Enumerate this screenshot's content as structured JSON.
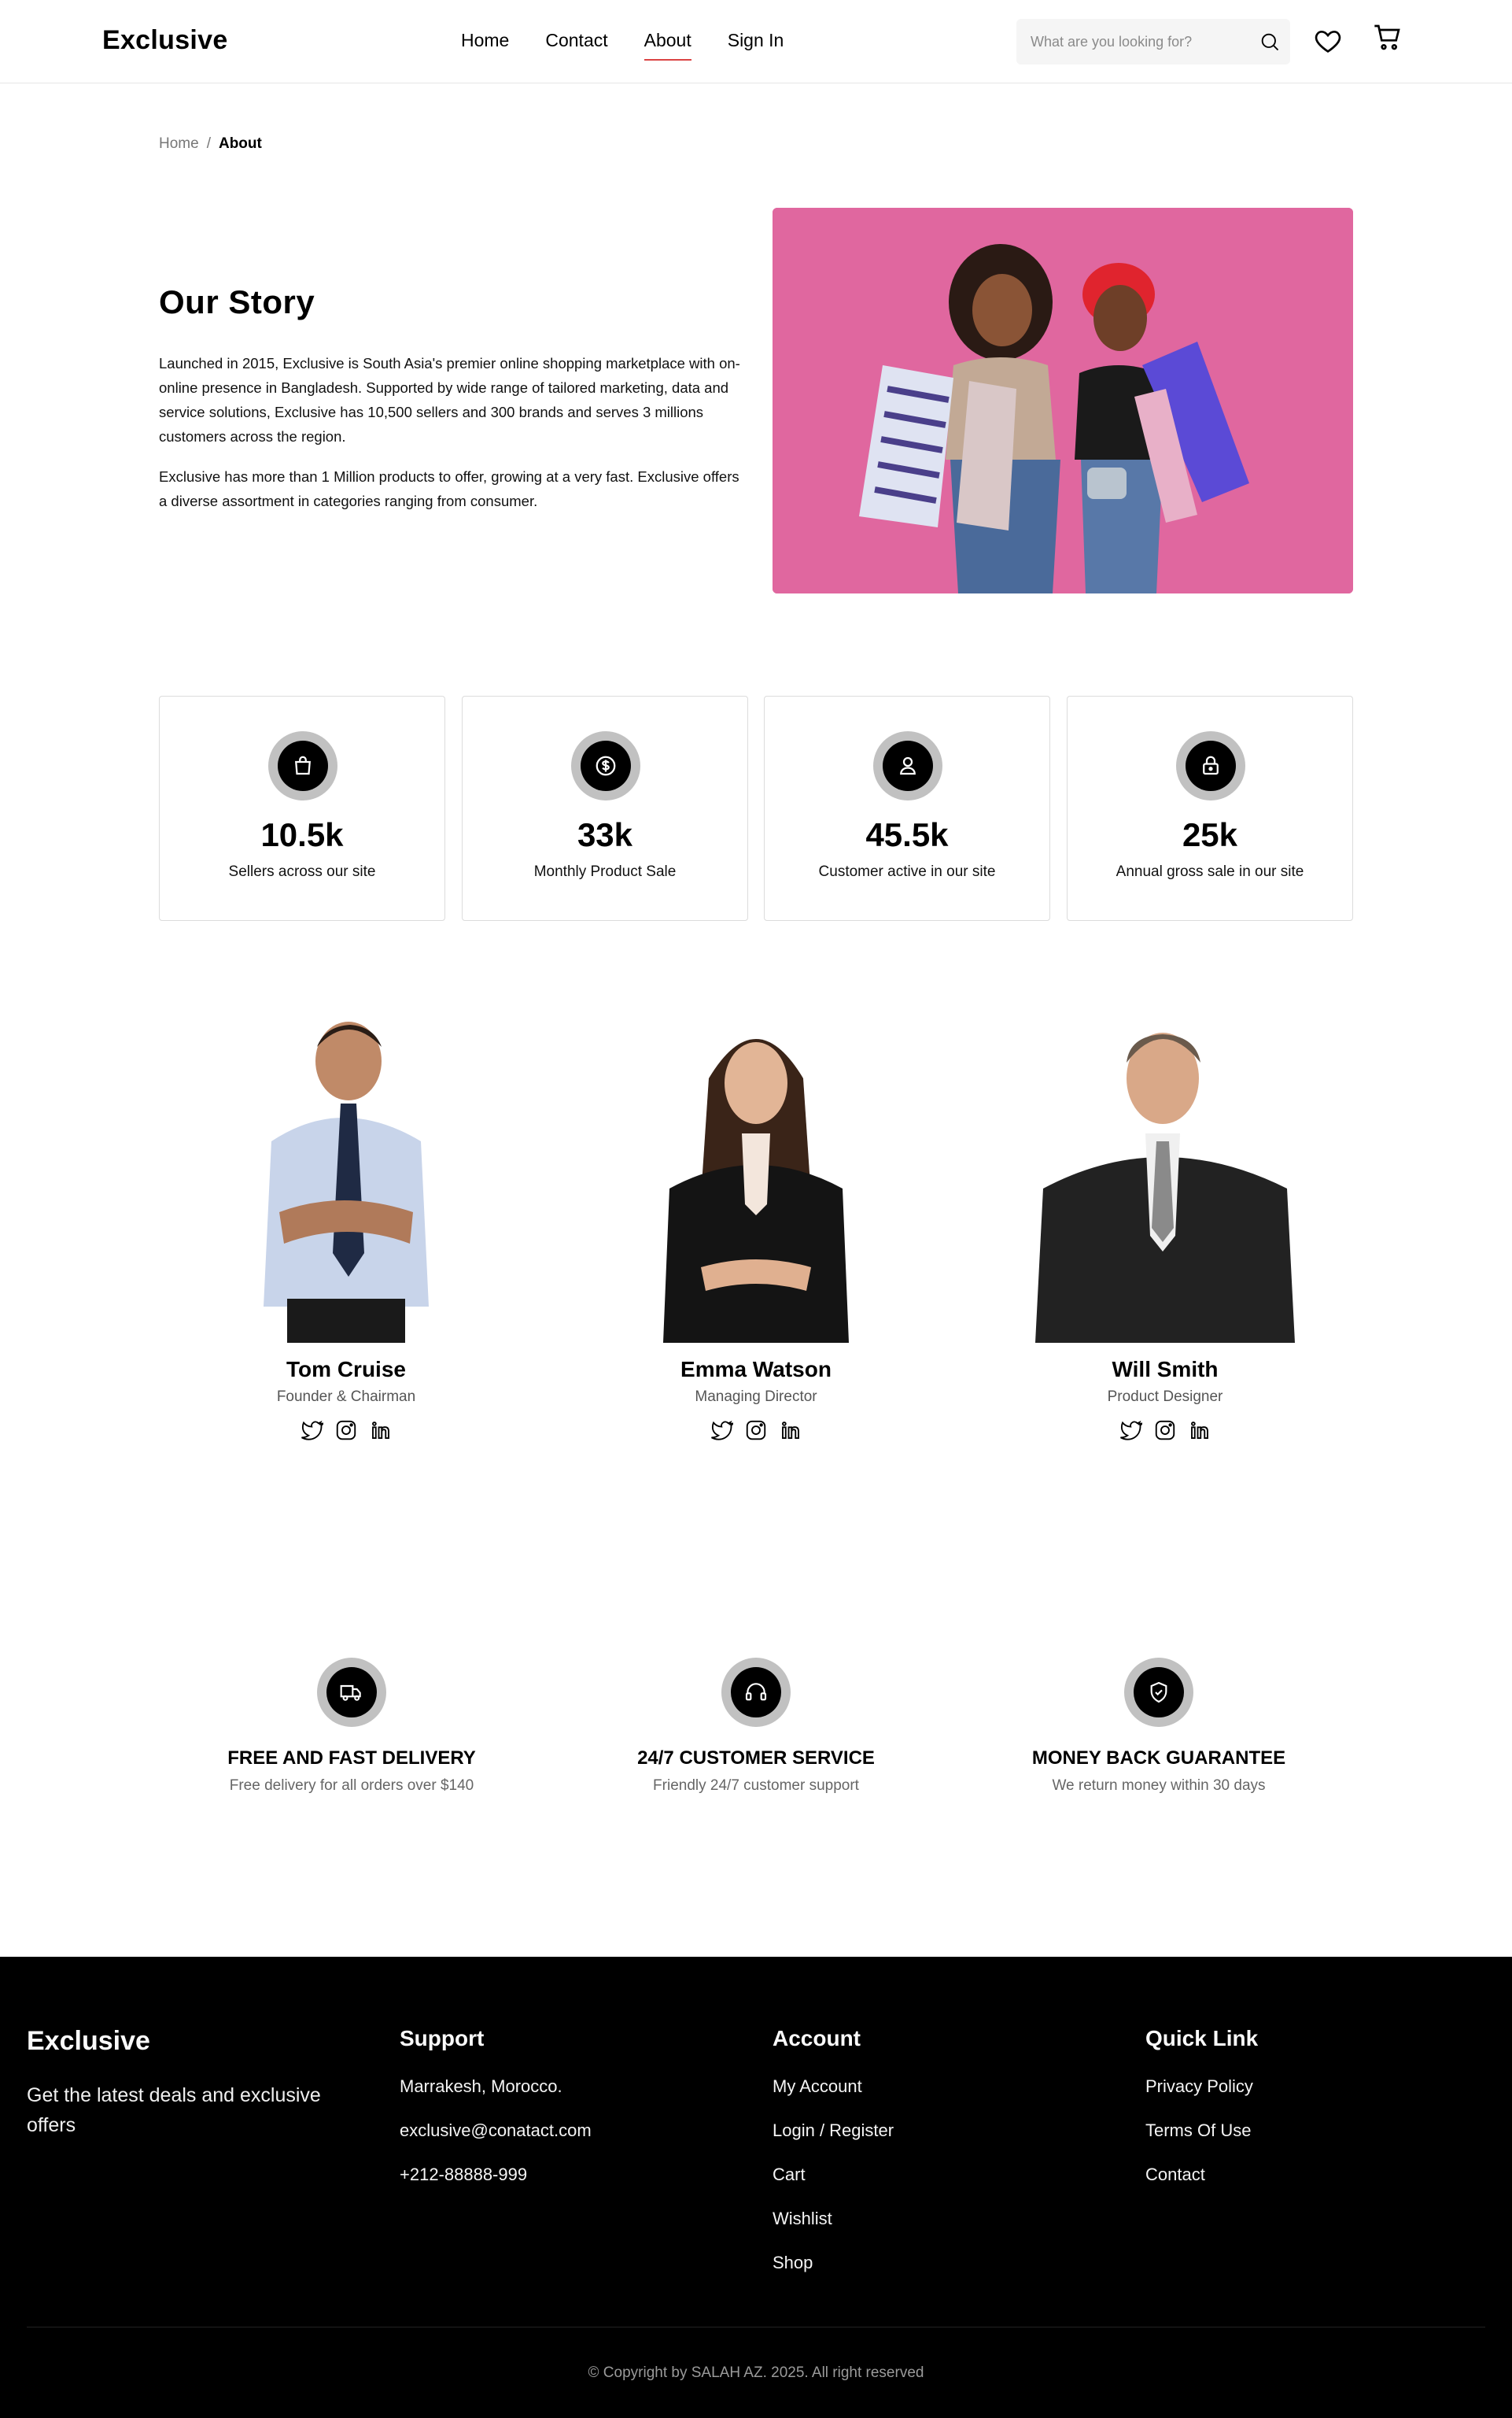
{
  "header": {
    "logo": "Exclusive",
    "nav": [
      "Home",
      "Contact",
      "About",
      "Sign In"
    ],
    "active_nav": "About",
    "search_placeholder": "What are you looking for?"
  },
  "breadcrumb": {
    "home": "Home",
    "separator": "/",
    "current": "About"
  },
  "story": {
    "title": "Our Story",
    "p1": "Launched in 2015, Exclusive is South Asia's premier online shopping marketplace with on-online presence in Bangladesh. Supported by wide range of tailored marketing, data and service solutions, Exclusive has 10,500 sellers and 300 brands and serves 3 millions customers across the region.",
    "p2": "Exclusive has more than 1 Million products to offer, growing at a very fast. Exclusive offers a diverse assortment in categories ranging from consumer."
  },
  "stats": [
    {
      "icon": "shopping-bag-icon",
      "value": "10.5k",
      "label": "Sellers across our site"
    },
    {
      "icon": "dollar-coin-icon",
      "value": "33k",
      "label": "Monthly Product Sale"
    },
    {
      "icon": "user-icon",
      "value": "45.5k",
      "label": "Customer active in our site"
    },
    {
      "icon": "lock-bag-icon",
      "value": "25k",
      "label": "Annual gross sale in our site"
    }
  ],
  "team": [
    {
      "name": "Tom Cruise",
      "role": "Founder & Chairman"
    },
    {
      "name": "Emma Watson",
      "role": "Managing Director"
    },
    {
      "name": "Will Smith",
      "role": "Product Designer"
    }
  ],
  "services": [
    {
      "icon": "delivery-truck-icon",
      "title": "FREE AND FAST DELIVERY",
      "desc": "Free delivery for all orders over $140"
    },
    {
      "icon": "headset-icon",
      "title": "24/7 CUSTOMER SERVICE",
      "desc": "Friendly 24/7 customer support"
    },
    {
      "icon": "shield-check-icon",
      "title": "MONEY BACK GUARANTEE",
      "desc": "We return money within 30 days"
    }
  ],
  "footer": {
    "brand": "Exclusive",
    "tagline": "Get the latest deals and exclusive offers",
    "support": {
      "heading": "Support",
      "items": [
        "Marrakesh, Morocco.",
        "exclusive@conatact.com",
        "+212-88888-999"
      ]
    },
    "account": {
      "heading": "Account",
      "items": [
        "My Account",
        "Login / Register",
        "Cart",
        "Wishlist",
        "Shop"
      ]
    },
    "quick": {
      "heading": "Quick Link",
      "items": [
        "Privacy Policy",
        "Terms Of Use",
        "Contact"
      ]
    },
    "copyright": "© Copyright by SALAH AZ. 2025. All right reserved"
  },
  "colors": {
    "accent": "#DB4444",
    "hero_bg": "#E0679F",
    "footer_bg": "#000000",
    "icon_ring": "#C1C1C1"
  }
}
